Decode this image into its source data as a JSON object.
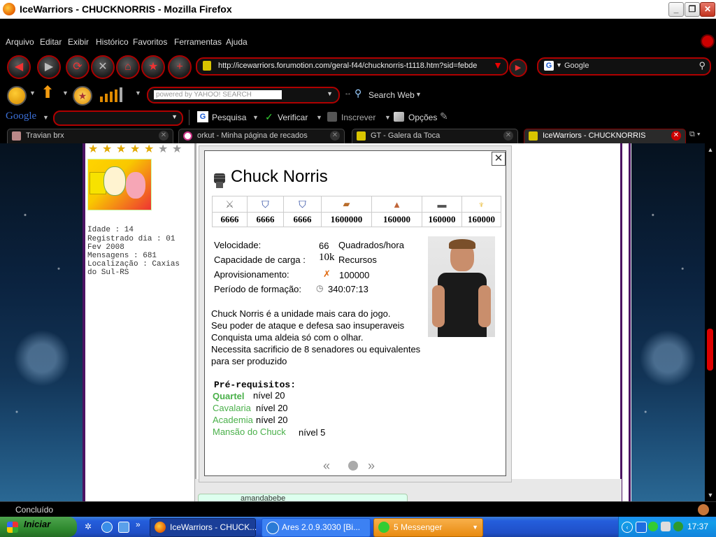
{
  "window": {
    "title": "IceWarriors - CHUCKNORRIS - Mozilla Firefox"
  },
  "menu": {
    "items": [
      "Arquivo",
      "Editar",
      "Exibir",
      "Histórico",
      "Favoritos",
      "Ferramentas",
      "Ajuda"
    ]
  },
  "navigation": {
    "url": "http://icewarriors.forumotion.com/geral-f44/chucknorris-t1118.htm?sid=febde",
    "search_engine": "Google"
  },
  "yahoo_toolbar": {
    "search_placeholder": "powered by YAHOO! SEARCH",
    "search_web_label": "Search Web"
  },
  "google_toolbar": {
    "logo": "Google",
    "pesquisa": "Pesquisa",
    "verificar": "Verificar",
    "inscrever": "Inscrever",
    "opcoes": "Opções"
  },
  "tabs": [
    {
      "label": "Travian brx",
      "active": false
    },
    {
      "label": "orkut - Minha página de recados",
      "active": false
    },
    {
      "label": "GT - Galera da Toca",
      "active": false
    },
    {
      "label": "IceWarriors - CHUCKNORRIS",
      "active": true
    }
  ],
  "user_profile": {
    "idade": "Idade : 14",
    "registrado": "Registrado dia : 01 Fev 2008",
    "mensagens": "Mensagens : 681",
    "localizacao": "Localização : Caxias do Sul-RS",
    "stars_filled": 5,
    "stars_total": 7
  },
  "unit": {
    "name": "Chuck Norris",
    "stats": [
      "6666",
      "6666",
      "6666",
      "1600000",
      "160000",
      "160000",
      "160000"
    ],
    "velocidade_label": "Velocidade:",
    "velocidade_value": "66",
    "velocidade_unit": "Quadrados/hora",
    "carga_label": "Capacidade de carga :",
    "carga_value": "10k",
    "carga_unit": "Recursos",
    "aprovisionamento_label": "Aprovisionamento:",
    "aprovisionamento_value": "100000",
    "formacao_label": "Período de formação:",
    "formacao_value": "340:07:13",
    "description": [
      "Chuck Norris é a unidade mais cara do jogo.",
      "Seu poder de ataque e defesa sao insuperaveis",
      "Conquista uma aldeia só com o olhar.",
      "Necessita sacrificio de 8 senadores ou equivalentes",
      "para ser produzido"
    ],
    "prereq_title": "Pré-requisitos:",
    "prerequisites": [
      {
        "name": "Quartel",
        "level": "nível  20"
      },
      {
        "name": "Cavalaria",
        "level": "nível 20"
      },
      {
        "name": "Academia",
        "level": "nível 20"
      },
      {
        "name": "Mansão do Chuck",
        "level": "nível 5"
      }
    ]
  },
  "post_footer_text": "amandabebe",
  "status": {
    "text": "Concluído"
  },
  "taskbar": {
    "start": "Iniciar",
    "tasks": [
      {
        "label": "IceWarriors - CHUCK..."
      },
      {
        "label": "Ares 2.0.9.3030   [Bi..."
      },
      {
        "label": "5 Messenger"
      }
    ],
    "clock": "17:37"
  },
  "colors": {
    "accent_red": "#b00000",
    "prereq_link": "#4ab04a",
    "taskbar_blue": "#245edc"
  }
}
